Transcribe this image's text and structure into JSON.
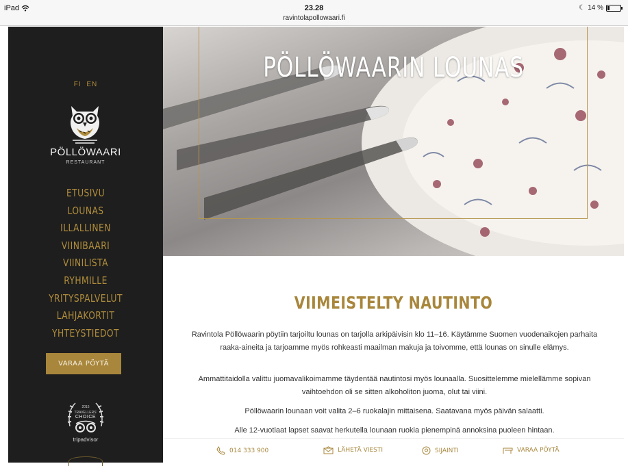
{
  "status_bar": {
    "device": "iPad",
    "wifi_icon": "wifi-icon",
    "time": "23.28",
    "url": "ravintolapollowaari.fi",
    "battery_text": "14 %",
    "battery_level": 0.14
  },
  "sidebar": {
    "languages": [
      "FI",
      "EN"
    ],
    "brand_name": "PÖLLÖWAARI",
    "brand_sub": "RESTAURANT",
    "nav": [
      "ETUSIVU",
      "LOUNAS",
      "ILLALLINEN",
      "VIINIBAARI",
      "VIINILISTA",
      "RYHMILLE",
      "YRITYSPALVELUT",
      "LAHJAKORTIT",
      "YHTEYSTIEDOT"
    ],
    "reserve_label": "VARAA PÖYTÄ",
    "tripadvisor": {
      "year": "2016",
      "line1": "TRAVELLERS'",
      "line2": "CHOICE",
      "word": "tripadvisor"
    }
  },
  "hero": {
    "title": "PÖLLÖWAARIN LOUNAS"
  },
  "main": {
    "heading": "VIIMEISTELTY NAUTINTO",
    "paragraphs": [
      "Ravintola Pöllöwaarin pöytiin tarjoiltu lounas on tarjolla arkipäivisin klo 11–16. Käytämme Suomen vuodenaikojen parhaita raaka-aineita ja tarjoamme myös rohkeasti maailman makuja ja toivomme, että lounas on sinulle elämys.",
      "Ammattitaidolla valittu juomavalikoimamme täydentää nautintosi myös lounaalla. Suosittelemme mielellämme sopivan vaihtoehdon oli se sitten alkoholiton juoma, olut tai viini.",
      "Pöllöwaarin lounaan voit valita 2–6 ruokalajin mittaisena. Saatavana myös päivän salaatti.",
      "Alle 12-vuotiaat lapset saavat herkutella lounaan ruokia pienempinä annoksina puoleen hintaan."
    ]
  },
  "footer": {
    "phone": "014 333 900",
    "message": "LÄHETÄ VIESTI",
    "location": "SIJAINTI",
    "reserve": "VARAA PÖYTÄ"
  },
  "colors": {
    "gold": "#a8863b",
    "sidebar_bg": "#1e1e1e"
  }
}
